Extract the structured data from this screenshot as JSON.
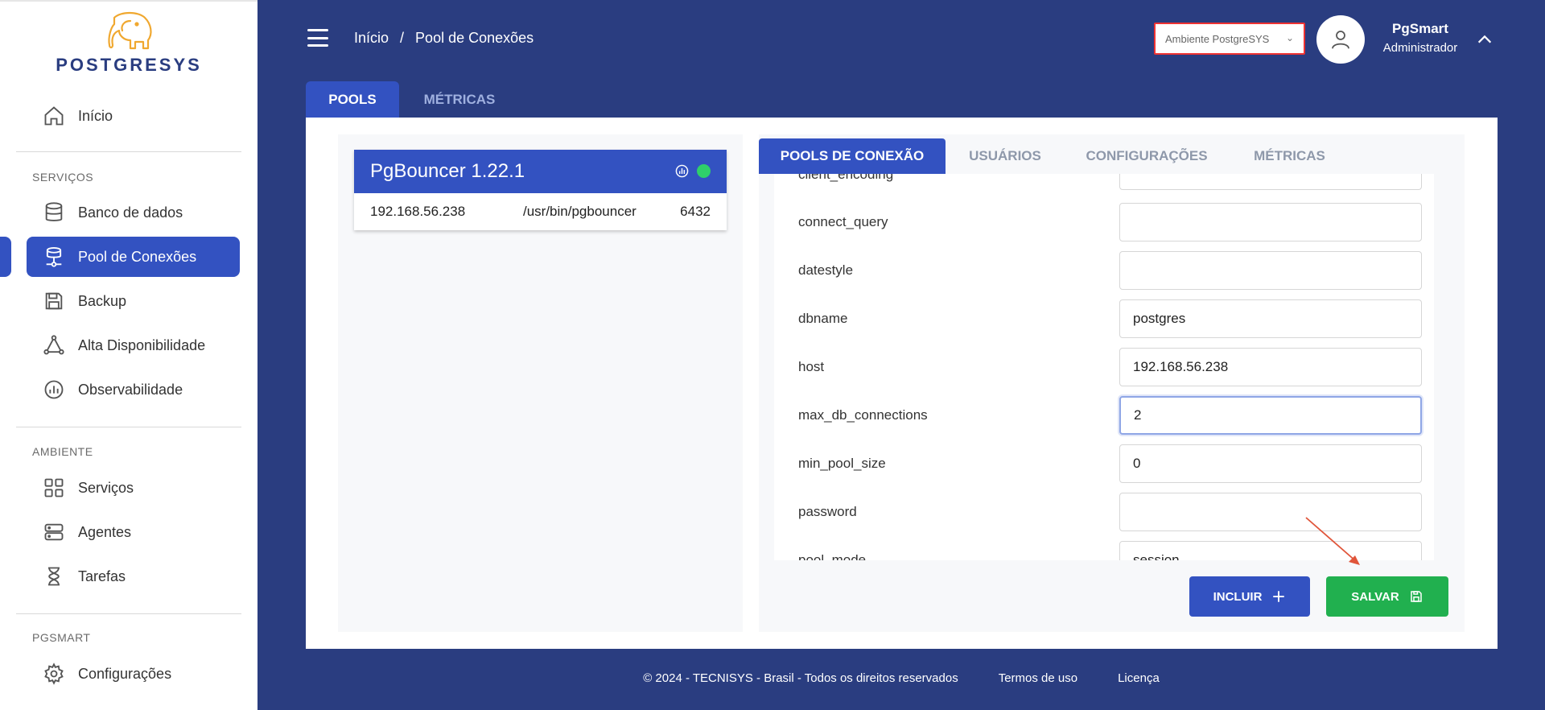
{
  "app": {
    "logo_text": "POSTGRESYS"
  },
  "sidebar": {
    "home": "Início",
    "sections": {
      "services": "SERVIÇOS",
      "environment": "AMBIENTE",
      "pgsmart": "PGSMART"
    },
    "services_items": [
      "Banco de dados",
      "Pool de Conexões",
      "Backup",
      "Alta Disponibilidade",
      "Observabilidade"
    ],
    "environment_items": [
      "Serviços",
      "Agentes",
      "Tarefas"
    ],
    "pgsmart_items": [
      "Configurações"
    ]
  },
  "header": {
    "breadcrumb": {
      "root": "Início",
      "separator": "/",
      "current": "Pool de Conexões"
    },
    "environment_select": "Ambiente PostgreSYS",
    "user": {
      "name": "PgSmart",
      "role": "Administrador"
    }
  },
  "top_tabs": [
    "POOLS",
    "MÉTRICAS"
  ],
  "pool": {
    "title": "PgBouncer 1.22.1",
    "host": "192.168.56.238",
    "path": "/usr/bin/pgbouncer",
    "port": "6432",
    "status_color": "#2fcf6a"
  },
  "inner_tabs": [
    "POOLS DE CONEXÃO",
    "USUÁRIOS",
    "CONFIGURAÇÕES",
    "MÉTRICAS"
  ],
  "form": {
    "fields": [
      {
        "label": "client_encoding",
        "value": ""
      },
      {
        "label": "connect_query",
        "value": ""
      },
      {
        "label": "datestyle",
        "value": ""
      },
      {
        "label": "dbname",
        "value": "postgres"
      },
      {
        "label": "host",
        "value": "192.168.56.238"
      },
      {
        "label": "max_db_connections",
        "value": "2"
      },
      {
        "label": "min_pool_size",
        "value": "0"
      },
      {
        "label": "password",
        "value": ""
      },
      {
        "label": "pool_mode",
        "value": "session"
      }
    ]
  },
  "buttons": {
    "include": "INCLUIR",
    "save": "SALVAR"
  },
  "footer": {
    "copyright": "© 2024 - TECNISYS - Brasil - Todos os direitos reservados",
    "terms": "Termos de uso",
    "license": "Licença"
  },
  "colors": {
    "primary": "#3352c1",
    "header_bg": "#2a3d80",
    "success": "#21b04f"
  }
}
